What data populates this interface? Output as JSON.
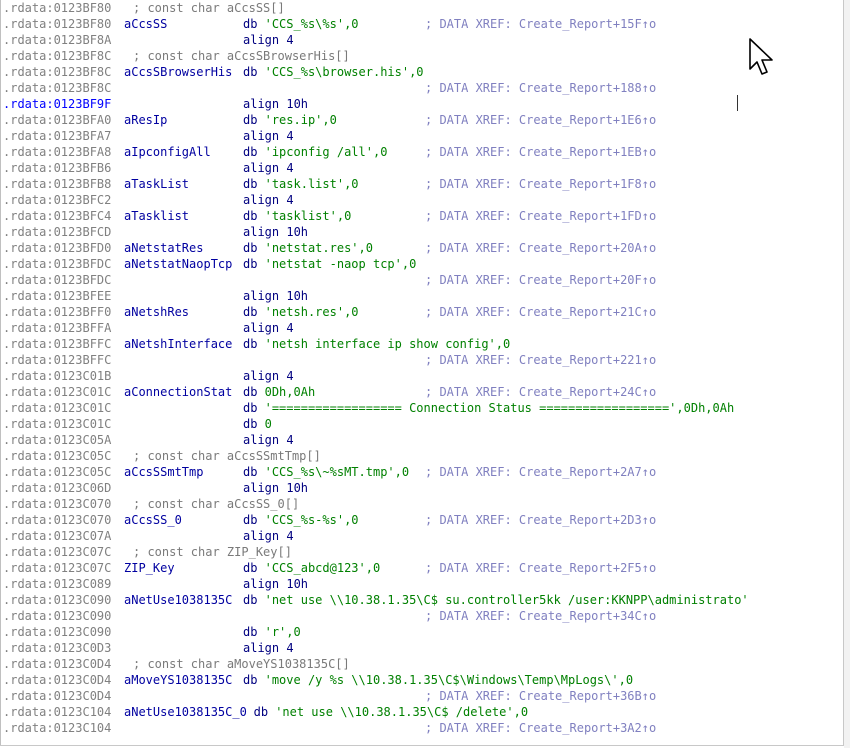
{
  "listing": {
    "lines": [
      {
        "addr": ".rdata:0123BF80",
        "label": "",
        "mnem": "; const char aCcsSS[]",
        "operands": "",
        "comment": "",
        "decl": true
      },
      {
        "addr": ".rdata:0123BF80",
        "label": "aCcsSS",
        "mnem": "db",
        "operands": "'CCS_%s\\%s',0",
        "comment": "; DATA XREF: Create_Report+15F↑o"
      },
      {
        "addr": ".rdata:0123BF8A",
        "label": "",
        "mnem": "align 4",
        "operands": "",
        "comment": ""
      },
      {
        "addr": ".rdata:0123BF8C",
        "label": "",
        "mnem": "; const char aCcsSBrowserHis[]",
        "operands": "",
        "comment": "",
        "decl": true
      },
      {
        "addr": ".rdata:0123BF8C",
        "label": "aCcsSBrowserHis",
        "mnem": "db",
        "operands": "'CCS_%s\\browser.his',0",
        "comment": ""
      },
      {
        "addr": ".rdata:0123BF8C",
        "label": "",
        "mnem": "",
        "operands": "",
        "comment": "; DATA XREF: Create_Report+188↑o"
      },
      {
        "addr": ".rdata:0123BF9F",
        "label": "",
        "mnem": "align 10h",
        "operands": "",
        "comment": "",
        "highlight": true
      },
      {
        "addr": ".rdata:0123BFA0",
        "label": "aResIp",
        "mnem": "db",
        "operands": "'res.ip',0",
        "comment": "; DATA XREF: Create_Report+1E6↑o"
      },
      {
        "addr": ".rdata:0123BFA7",
        "label": "",
        "mnem": "align 4",
        "operands": "",
        "comment": ""
      },
      {
        "addr": ".rdata:0123BFA8",
        "label": "aIpconfigAll",
        "mnem": "db",
        "operands": "'ipconfig /all',0",
        "comment": "; DATA XREF: Create_Report+1EB↑o"
      },
      {
        "addr": ".rdata:0123BFB6",
        "label": "",
        "mnem": "align 4",
        "operands": "",
        "comment": ""
      },
      {
        "addr": ".rdata:0123BFB8",
        "label": "aTaskList",
        "mnem": "db",
        "operands": "'task.list',0",
        "comment": "; DATA XREF: Create_Report+1F8↑o"
      },
      {
        "addr": ".rdata:0123BFC2",
        "label": "",
        "mnem": "align 4",
        "operands": "",
        "comment": ""
      },
      {
        "addr": ".rdata:0123BFC4",
        "label": "aTasklist",
        "mnem": "db",
        "operands": "'tasklist',0",
        "comment": "; DATA XREF: Create_Report+1FD↑o"
      },
      {
        "addr": ".rdata:0123BFCD",
        "label": "",
        "mnem": "align 10h",
        "operands": "",
        "comment": ""
      },
      {
        "addr": ".rdata:0123BFD0",
        "label": "aNetstatRes",
        "mnem": "db",
        "operands": "'netstat.res',0",
        "comment": "; DATA XREF: Create_Report+20A↑o"
      },
      {
        "addr": ".rdata:0123BFDC",
        "label": "aNetstatNaopTcp",
        "mnem": "db",
        "operands": "'netstat -naop tcp',0",
        "comment": ""
      },
      {
        "addr": ".rdata:0123BFDC",
        "label": "",
        "mnem": "",
        "operands": "",
        "comment": "; DATA XREF: Create_Report+20F↑o"
      },
      {
        "addr": ".rdata:0123BFEE",
        "label": "",
        "mnem": "align 10h",
        "operands": "",
        "comment": ""
      },
      {
        "addr": ".rdata:0123BFF0",
        "label": "aNetshRes",
        "mnem": "db",
        "operands": "'netsh.res',0",
        "comment": "; DATA XREF: Create_Report+21C↑o"
      },
      {
        "addr": ".rdata:0123BFFA",
        "label": "",
        "mnem": "align 4",
        "operands": "",
        "comment": ""
      },
      {
        "addr": ".rdata:0123BFFC",
        "label": "aNetshInterface",
        "mnem": "db",
        "operands": "'netsh interface ip show config',0",
        "comment": ""
      },
      {
        "addr": ".rdata:0123BFFC",
        "label": "",
        "mnem": "",
        "operands": "",
        "comment": "; DATA XREF: Create_Report+221↑o"
      },
      {
        "addr": ".rdata:0123C01B",
        "label": "",
        "mnem": "align 4",
        "operands": "",
        "comment": ""
      },
      {
        "addr": ".rdata:0123C01C",
        "label": "aConnectionStat",
        "mnem": "db",
        "operands": "0Dh,0Ah",
        "comment": "; DATA XREF: Create_Report+24C↑o"
      },
      {
        "addr": ".rdata:0123C01C",
        "label": "",
        "mnem": "db",
        "operands": "'================== Connection Status ==================',0Dh,0Ah",
        "comment": ""
      },
      {
        "addr": ".rdata:0123C01C",
        "label": "",
        "mnem": "db",
        "operands": "0",
        "comment": ""
      },
      {
        "addr": ".rdata:0123C05A",
        "label": "",
        "mnem": "align 4",
        "operands": "",
        "comment": ""
      },
      {
        "addr": ".rdata:0123C05C",
        "label": "",
        "mnem": "; const char aCcsSSmtTmp[]",
        "operands": "",
        "comment": "",
        "decl": true
      },
      {
        "addr": ".rdata:0123C05C",
        "label": "aCcsSSmtTmp",
        "mnem": "db",
        "operands": "'CCS_%s\\~%sMT.tmp',0",
        "comment": "; DATA XREF: Create_Report+2A7↑o"
      },
      {
        "addr": ".rdata:0123C06D",
        "label": "",
        "mnem": "align 10h",
        "operands": "",
        "comment": ""
      },
      {
        "addr": ".rdata:0123C070",
        "label": "",
        "mnem": "; const char aCcsSS_0[]",
        "operands": "",
        "comment": "",
        "decl": true
      },
      {
        "addr": ".rdata:0123C070",
        "label": "aCcsSS_0",
        "mnem": "db",
        "operands": "'CCS_%s-%s',0",
        "comment": "; DATA XREF: Create_Report+2D3↑o"
      },
      {
        "addr": ".rdata:0123C07A",
        "label": "",
        "mnem": "align 4",
        "operands": "",
        "comment": ""
      },
      {
        "addr": ".rdata:0123C07C",
        "label": "",
        "mnem": "; const char ZIP_Key[]",
        "operands": "",
        "comment": "",
        "decl": true
      },
      {
        "addr": ".rdata:0123C07C",
        "label": "ZIP_Key",
        "mnem": "db",
        "operands": "'CCS_abcd@123',0",
        "comment": "; DATA XREF: Create_Report+2F5↑o",
        "blue_label": true
      },
      {
        "addr": ".rdata:0123C089",
        "label": "",
        "mnem": "align 10h",
        "operands": "",
        "comment": ""
      },
      {
        "addr": ".rdata:0123C090",
        "label": "aNetUse1038135C",
        "mnem": "db",
        "operands": "'net use \\\\10.38.1.35\\C$ su.controller5kk /user:KKNPP\\administrato'",
        "comment": ""
      },
      {
        "addr": ".rdata:0123C090",
        "label": "",
        "mnem": "",
        "operands": "",
        "comment": "; DATA XREF: Create_Report+34C↑o"
      },
      {
        "addr": ".rdata:0123C090",
        "label": "",
        "mnem": "db",
        "operands": "'r',0",
        "comment": ""
      },
      {
        "addr": ".rdata:0123C0D3",
        "label": "",
        "mnem": "align 4",
        "operands": "",
        "comment": ""
      },
      {
        "addr": ".rdata:0123C0D4",
        "label": "",
        "mnem": "; const char aMoveYS1038135C[]",
        "operands": "",
        "comment": "",
        "decl": true
      },
      {
        "addr": ".rdata:0123C0D4",
        "label": "aMoveYS1038135C",
        "mnem": "db",
        "operands": "'move /y %s \\\\10.38.1.35\\C$\\Windows\\Temp\\MpLogs\\',0",
        "comment": ""
      },
      {
        "addr": ".rdata:0123C0D4",
        "label": "",
        "mnem": "",
        "operands": "",
        "comment": "; DATA XREF: Create_Report+36B↑o"
      },
      {
        "addr": ".rdata:0123C104",
        "label": "aNetUse1038135C_0",
        "mnem": "db",
        "operands": "'net use \\\\10.38.1.35\\C$ /delete',0",
        "comment": ""
      },
      {
        "addr": ".rdata:0123C104",
        "label": "",
        "mnem": "",
        "operands": "",
        "comment": "; DATA XREF: Create_Report+3A2↑o"
      }
    ]
  },
  "icons": {
    "mouse_cursor": "arrow-cursor-icon",
    "text_caret": "text-caret-icon"
  },
  "colors": {
    "address": "#808080",
    "address_highlight": "#0000ff",
    "label": "#0000a0",
    "mnemonic": "#000080",
    "string": "#008000",
    "comment": "#8080c0",
    "declaration": "#7a7a7a"
  }
}
